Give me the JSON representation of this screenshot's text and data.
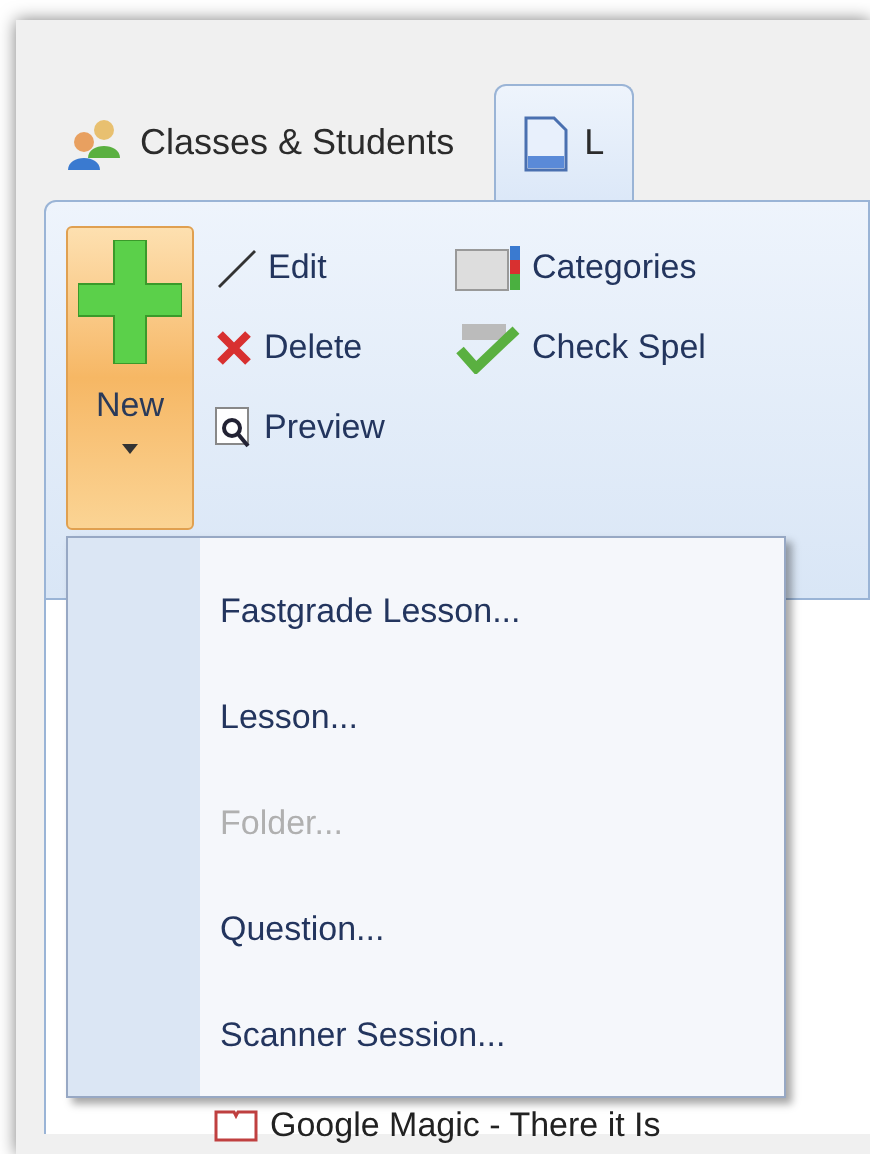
{
  "tabs": [
    {
      "label": "Classes & Students",
      "selected": false
    },
    {
      "label": "L",
      "selected": true
    }
  ],
  "ribbon": {
    "new_button": {
      "label": "New"
    },
    "commands": [
      {
        "label": "Edit"
      },
      {
        "label": "Delete"
      },
      {
        "label": "Preview"
      }
    ],
    "commands_2": [
      {
        "label": "Categories"
      },
      {
        "label": "Check Spel"
      }
    ]
  },
  "menu": {
    "items": [
      {
        "label": "Fastgrade Lesson...",
        "disabled": false
      },
      {
        "label": "Lesson...",
        "disabled": false
      },
      {
        "label": "Folder...",
        "disabled": true
      },
      {
        "label": "Question...",
        "disabled": false
      },
      {
        "label": "Scanner Session...",
        "disabled": false
      }
    ]
  },
  "tree": {
    "items": [
      {
        "label": "Google Magic - There it Is"
      }
    ]
  }
}
